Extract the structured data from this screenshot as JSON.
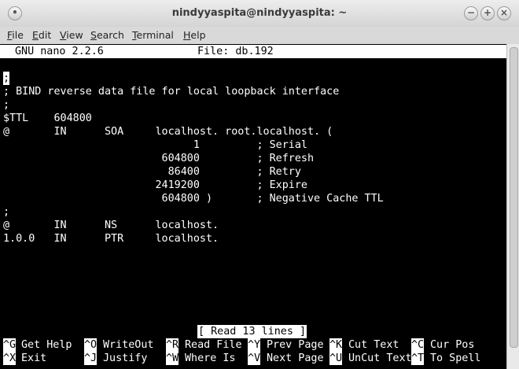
{
  "window": {
    "title": "nindyyaspita@nindyyaspita: ~"
  },
  "menu": [
    {
      "mn": "F",
      "rest": "ile"
    },
    {
      "mn": "E",
      "rest": "dit"
    },
    {
      "mn": "V",
      "rest": "iew"
    },
    {
      "mn": "S",
      "rest": "earch"
    },
    {
      "mn": "T",
      "rest": "erminal"
    },
    {
      "mn": "H",
      "rest": "elp"
    }
  ],
  "nano": {
    "version": "GNU nano 2.2.6",
    "file": "File: db.192",
    "cursor_char": ";",
    "lines": [
      "; BIND reverse data file for local loopback interface",
      ";",
      "$TTL    604800",
      "@       IN      SOA     localhost. root.localhost. (",
      "                              1         ; Serial",
      "                         604800         ; Refresh",
      "                          86400         ; Retry",
      "                        2419200         ; Expire",
      "                         604800 )       ; Negative Cache TTL",
      ";",
      "@       IN      NS      localhost.",
      "1.0.0   IN      PTR     localhost."
    ],
    "status": "[ Read 13 lines ]",
    "shortcuts_row1": [
      {
        "key": "^G",
        "label": "Get Help"
      },
      {
        "key": "^O",
        "label": "WriteOut"
      },
      {
        "key": "^R",
        "label": "Read File"
      },
      {
        "key": "^Y",
        "label": "Prev Page"
      },
      {
        "key": "^K",
        "label": "Cut Text"
      },
      {
        "key": "^C",
        "label": "Cur Pos"
      }
    ],
    "shortcuts_row2": [
      {
        "key": "^X",
        "label": "Exit"
      },
      {
        "key": "^J",
        "label": "Justify"
      },
      {
        "key": "^W",
        "label": "Where Is"
      },
      {
        "key": "^V",
        "label": "Next Page"
      },
      {
        "key": "^U",
        "label": "UnCut Text"
      },
      {
        "key": "^T",
        "label": "To Spell"
      }
    ]
  }
}
